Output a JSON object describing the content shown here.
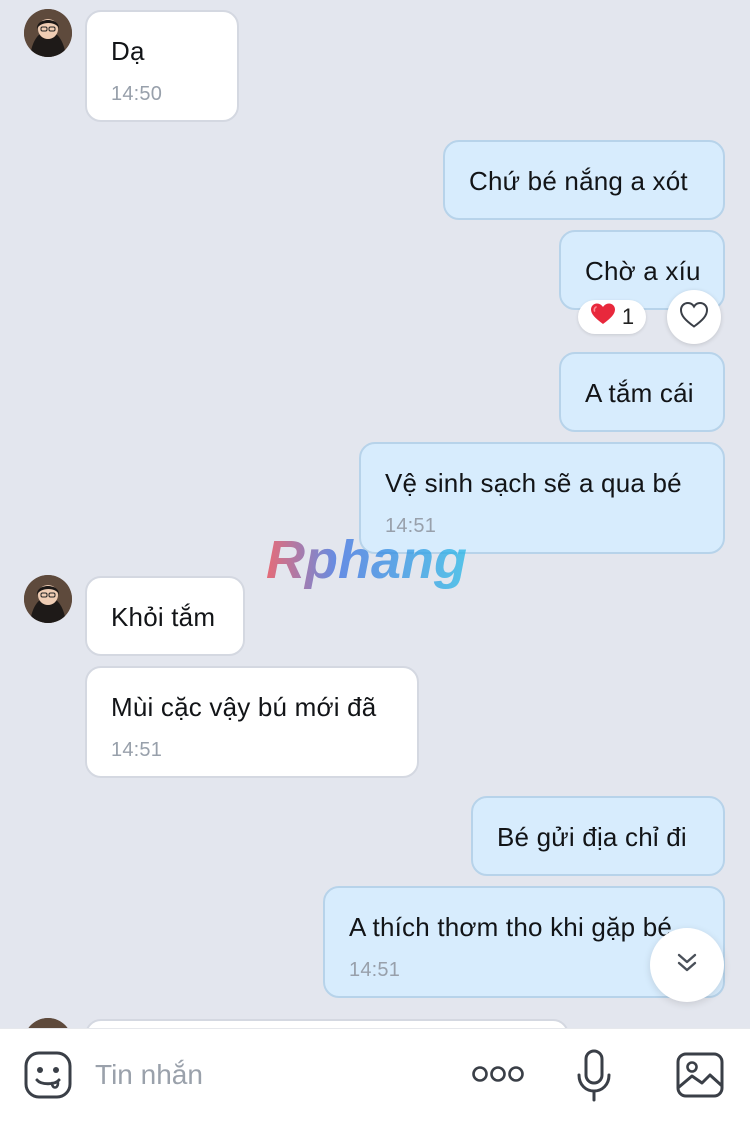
{
  "messages": [
    {
      "id": "m1",
      "direction": "in",
      "text": "Dạ",
      "time": "14:50"
    },
    {
      "id": "m2",
      "direction": "out",
      "text": "Chứ bé nắng a xót",
      "time": ""
    },
    {
      "id": "m3",
      "direction": "out",
      "text": "Chờ a xíu",
      "time": "",
      "reaction": {
        "emoji": "❤️",
        "count": "1"
      }
    },
    {
      "id": "m4",
      "direction": "out",
      "text": "A tắm cái",
      "time": ""
    },
    {
      "id": "m5",
      "direction": "out",
      "text": "Vệ sinh sạch sẽ a qua bé",
      "time": "14:51"
    },
    {
      "id": "m6",
      "direction": "in",
      "text": "Khỏi tắm",
      "time": ""
    },
    {
      "id": "m7",
      "direction": "in",
      "text": "Mùi cặc vậy bú mới đã",
      "time": "14:51"
    },
    {
      "id": "m8",
      "direction": "out",
      "text": "Bé gửi địa chỉ đi",
      "time": ""
    },
    {
      "id": "m9",
      "direction": "out",
      "text": "A thích thơm tho khi gặp bé",
      "time": "14:51"
    }
  ],
  "watermark": {
    "text": "Rphang"
  },
  "composer": {
    "placeholder": "Tin nhắn",
    "icons": [
      "sticker-icon",
      "more-icon",
      "microphone-icon",
      "image-icon"
    ]
  },
  "colors": {
    "background": "#e3e6ee",
    "incoming_bubble": "#ffffff",
    "outgoing_bubble": "#d7ecfd",
    "timestamp": "#98a0ab",
    "reaction_heart": "#e8283c"
  }
}
